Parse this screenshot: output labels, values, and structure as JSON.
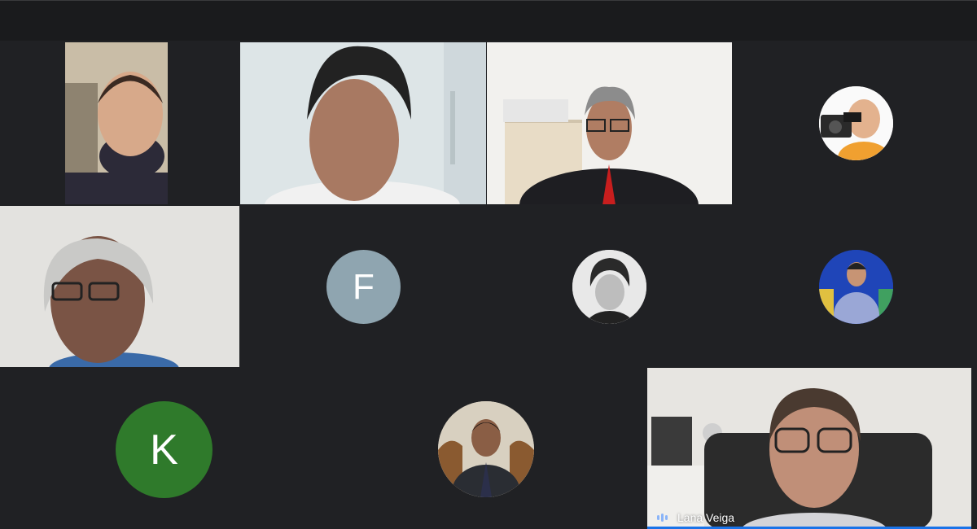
{
  "colors": {
    "background": "#202124",
    "avatar_f": "#8fa5b0",
    "avatar_k": "#2f7a2b",
    "speaker_indicator": "#8ab4f8"
  },
  "participants": {
    "f": {
      "initial": "F"
    },
    "k": {
      "initial": "K"
    },
    "active": {
      "name": "Lana Veiga"
    }
  }
}
